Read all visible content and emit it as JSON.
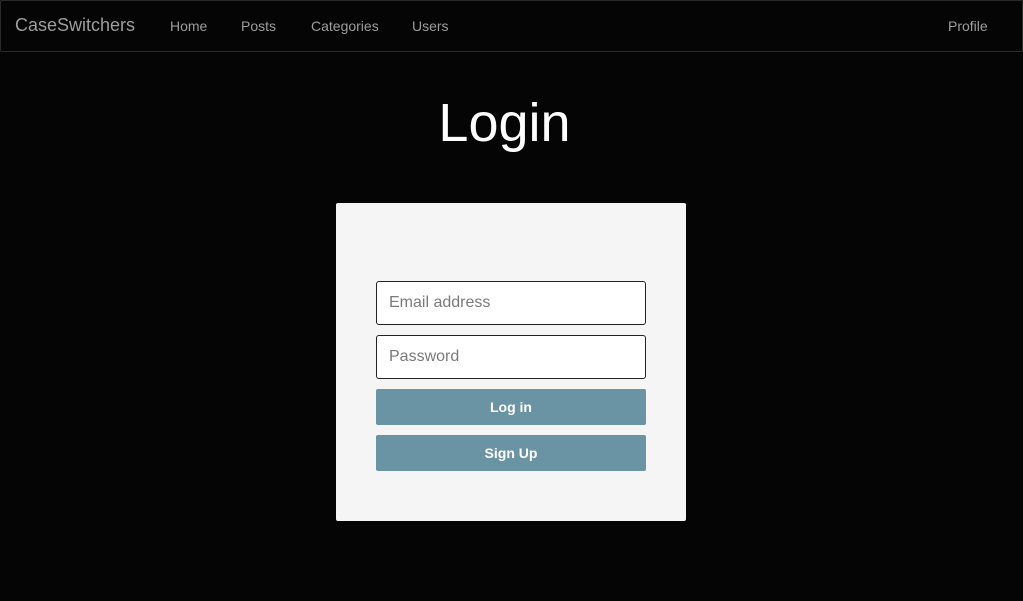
{
  "navbar": {
    "brand": "CaseSwitchers",
    "links": {
      "home": "Home",
      "posts": "Posts",
      "categories": "Categories",
      "users": "Users"
    },
    "profile": "Profile"
  },
  "page": {
    "title": "Login"
  },
  "form": {
    "email_placeholder": "Email address",
    "email_value": "",
    "password_placeholder": "Password",
    "password_value": "",
    "login_label": "Log in",
    "signup_label": "Sign Up"
  },
  "colors": {
    "background": "#050505",
    "card": "#f5f5f5",
    "button": "#6a93a4",
    "nav_text": "#9d9d9d"
  }
}
